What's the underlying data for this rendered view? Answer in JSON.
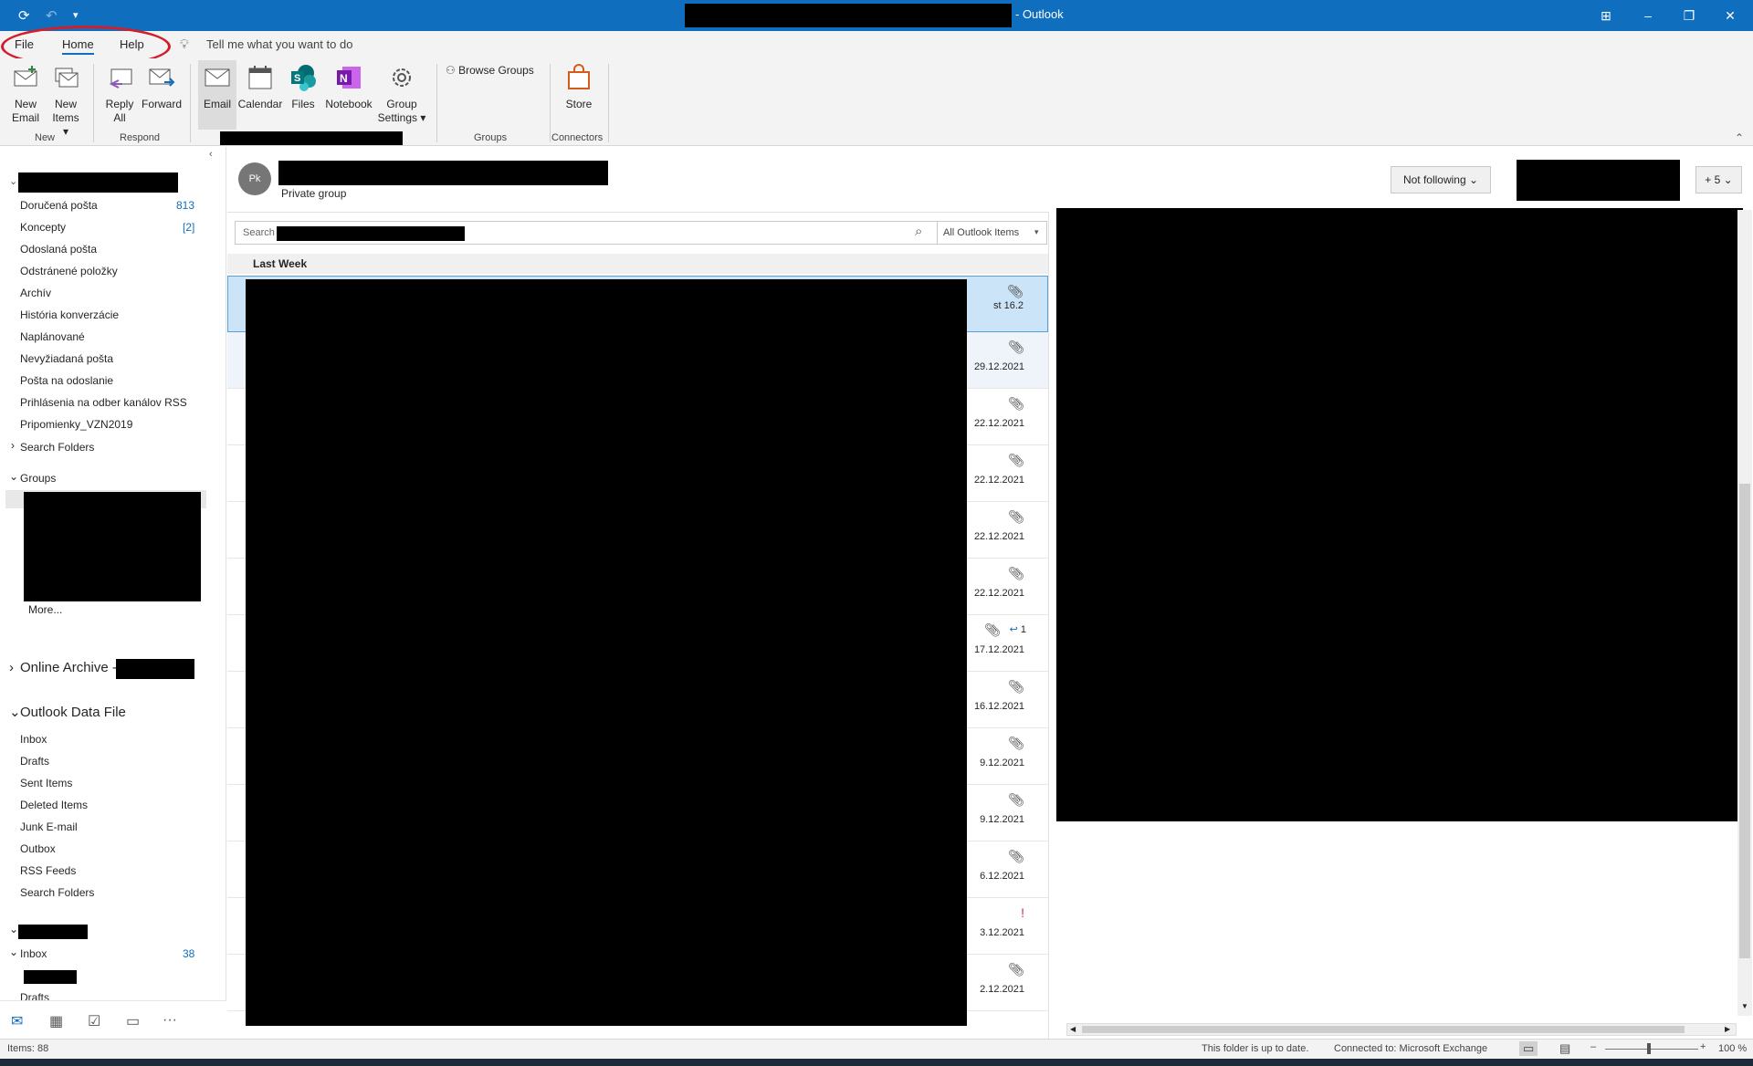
{
  "titlebar": {
    "app_name": "- Outlook"
  },
  "menu": {
    "file": "File",
    "home": "Home",
    "help": "Help",
    "tell_me": "Tell me what you want to do"
  },
  "ribbon": {
    "new_email": "New\nEmail",
    "new_email_1": "New",
    "new_email_2": "Email",
    "new_items_1": "New",
    "new_items_2": "Items",
    "reply_all_1": "Reply",
    "reply_all_2": "All",
    "forward": "Forward",
    "email": "Email",
    "calendar": "Calendar",
    "files": "Files",
    "notebook": "Notebook",
    "group_settings_1": "Group",
    "group_settings_2": "Settings",
    "browse_groups": "Browse Groups",
    "store": "Store",
    "groups": {
      "new": "New",
      "respond": "Respond",
      "groups": "Groups",
      "connectors": "Connectors"
    }
  },
  "folders": {
    "account1": [
      {
        "label": "Doručená pošta",
        "count": "813"
      },
      {
        "label": "Koncepty",
        "count": "[2]"
      },
      {
        "label": "Odoslaná pošta",
        "count": ""
      },
      {
        "label": "Odstránené položky",
        "count": ""
      },
      {
        "label": "Archív",
        "count": ""
      },
      {
        "label": "História konverzácie",
        "count": ""
      },
      {
        "label": "Naplánované",
        "count": ""
      },
      {
        "label": "Nevyžiadaná pošta",
        "count": ""
      },
      {
        "label": "Pošta na odoslanie",
        "count": ""
      },
      {
        "label": "Prihlásenia na odber kanálov RSS",
        "count": ""
      },
      {
        "label": "Pripomienky_VZN2019",
        "count": ""
      }
    ],
    "search_folders": "Search Folders",
    "groups_header": "Groups",
    "more": "More...",
    "online_archive": "Online Archive -",
    "data_file_header": "Outlook Data File",
    "data_file": [
      "Inbox",
      "Drafts",
      "Sent Items",
      "Deleted Items",
      "Junk E-mail",
      "Outbox",
      "RSS Feeds",
      "Search Folders"
    ],
    "account3_inbox": "Inbox",
    "account3_inbox_count": "38",
    "account3_drafts": "Drafts"
  },
  "group_header": {
    "avatar": "Pk",
    "subtitle": "Private group",
    "follow": "Not following",
    "members": "+ 5"
  },
  "search": {
    "placeholder": "Search",
    "scope": "All Outlook Items"
  },
  "list": {
    "section": "Last Week",
    "rows": [
      {
        "date": "st 16.2",
        "flag": ""
      },
      {
        "date": "29.12.2021",
        "flag": ""
      },
      {
        "date": "22.12.2021",
        "flag": ""
      },
      {
        "date": "22.12.2021",
        "flag": ""
      },
      {
        "date": "22.12.2021",
        "flag": ""
      },
      {
        "date": "22.12.2021",
        "flag": ""
      },
      {
        "date": "17.12.2021",
        "flag": "1"
      },
      {
        "date": "16.12.2021",
        "flag": ""
      },
      {
        "date": "9.12.2021",
        "flag": ""
      },
      {
        "date": "9.12.2021",
        "flag": ""
      },
      {
        "date": "6.12.2021",
        "flag": ""
      },
      {
        "date": "3.12.2021",
        "flag": "!"
      },
      {
        "date": "2.12.2021",
        "flag": ""
      }
    ]
  },
  "status": {
    "items": "Items: 88",
    "uptodate": "This folder is up to date.",
    "connected": "Connected to: Microsoft Exchange",
    "zoom": "100 %"
  },
  "colors": {
    "accent": "#106ebe",
    "circle": "#d21e2a"
  }
}
